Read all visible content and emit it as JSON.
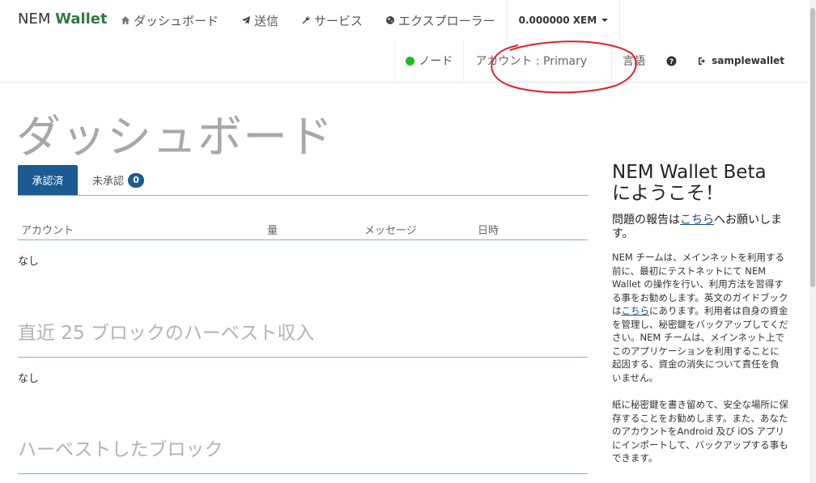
{
  "brand": {
    "prefix": "NEM",
    "suffix": "Wallet"
  },
  "nav": {
    "dashboard": "ダッシュボード",
    "send": "送信",
    "services": "サービス",
    "explorer": "エクスプローラー",
    "balance": "0.000000 XEM"
  },
  "nav2": {
    "node": "ノード",
    "account": "アカウント : Primary",
    "language": "言語",
    "wallet": "samplewallet"
  },
  "page": {
    "title": "ダッシュボード"
  },
  "tabs": {
    "confirmed": "承認済",
    "unconfirmed": "未承認",
    "unconfirmed_count": "0"
  },
  "table": {
    "headers": [
      "アカウント",
      "量",
      "メッセージ",
      "日時"
    ],
    "empty": "なし"
  },
  "harvest": {
    "title": "直近 25 ブロックのハーベスト収入",
    "empty": "なし"
  },
  "harvested": {
    "title": "ハーベストしたブロック"
  },
  "sidebar": {
    "heading_line1": "NEM Wallet Beta",
    "heading_line2": "にようこそ！",
    "report_prefix": "問題の報告は",
    "report_link": "こちら",
    "report_suffix": "へお願いします。",
    "para1_a": "NEM チームは、メインネットを利用する前に、最初にテストネットにて NEM Wallet の操作を行い、利用方法を習得する事をお勧めします。英文のガイドブックは",
    "para1_link": "こちら",
    "para1_b": "にあります。利用者は自身の資金を管理し、秘密鍵をバックアップしてください。NEM チームは、メインネット上でこのアプリケーションを利用することに起因する、資金の消失について責任を負いません。",
    "para2": "紙に秘密鍵を書き留めて、安全な場所に保存することをお勧めします。また、あなたのアカウントをAndroid 及び iOS アプリにインポートして、バックアップする事もできます。"
  },
  "colors": {
    "accent": "#1b5b92",
    "brand_green": "#2d7a40",
    "node_ok": "#1fbd22",
    "annotation": "#e0202a"
  }
}
